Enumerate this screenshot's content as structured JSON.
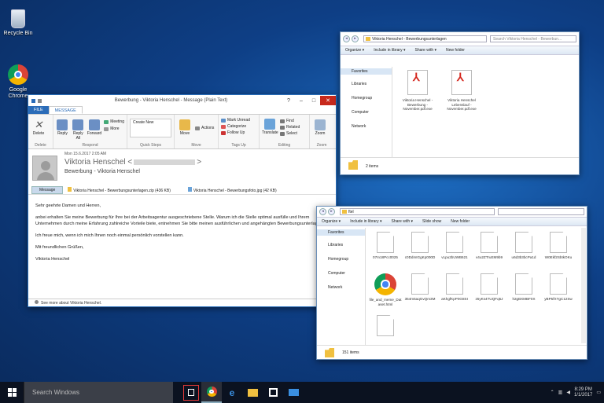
{
  "desktop": {
    "icons": [
      {
        "label": "Recycle Bin",
        "icon": "recycle-bin-icon"
      },
      {
        "label": "Google Chrome",
        "icon": "chrome-icon"
      }
    ]
  },
  "outlook": {
    "title": "Bewerbung - Viktoria Henschel - Message (Plain Text)",
    "tabs": [
      "FILE",
      "MESSAGE"
    ],
    "ribbon": {
      "delete": {
        "button": "Delete",
        "caption": "Delete"
      },
      "respond": {
        "reply": "Reply",
        "reply_all": "Reply All",
        "forward": "Forward",
        "meeting": "Meeting",
        "more": "More",
        "caption": "Respond"
      },
      "quicksteps": {
        "item": "Create New",
        "caption": "Quick Steps"
      },
      "move": {
        "move": "Move",
        "actions": "Actions",
        "caption": "Move"
      },
      "tags": {
        "mark_unread": "Mark Unread",
        "categorize": "Categorize",
        "follow_up": "Follow Up",
        "caption": "Tags Up"
      },
      "editing": {
        "translate": "Translate",
        "find": "Find",
        "related": "Related",
        "select": "Select",
        "caption": "Editing"
      },
      "zoom": {
        "zoom": "Zoom",
        "caption": "Zoom"
      }
    },
    "header": {
      "date": "Mon 15.6.2017 2:05 AM",
      "sender": "Viktoria Henschel <",
      "sender_end": ">",
      "subject": "Bewerbung - Viktoria Henschel"
    },
    "attachments": {
      "message_btn": "Message",
      "files": [
        "Viktoria Henschel - Bewerbungsunterlagen.zip (436 KB)",
        "Viktoria Henschel - Bewerbungsfoto.jpg (42 KB)"
      ]
    },
    "body": [
      "Sehr geehrte Damen und Herren,",
      "anbei erhalten Sie meine Bewerbung für Ihre bei der Arbeitsagentur ausgeschriebene Stelle. Warum ich die Stelle optimal ausfülle und Ihrem Unternehmen durch meine Erfahrung zahlreiche Vorteile biete, entnehmen Sie bitte meinen ausführlichen und angehängten Bewerbungsunterlagen.",
      "Ich freue mich, wenn ich mich Ihnen noch einmal persönlich vorstellen kann.",
      "Mit freundlichen Grüßen,",
      "Viktoria Henschel"
    ],
    "people_bar": "See more about Viktoria Henschel."
  },
  "explorer1": {
    "address": "Viktoria Henschel - Bewerbungsunterlagen",
    "search_placeholder": "Search Viktoria Henschel - Bewerbun...",
    "commands": [
      "Organize ▾",
      "Include in library ▾",
      "Share with ▾",
      "New folder"
    ],
    "nav": [
      "Favorites",
      "Libraries",
      "Homegroup",
      "Computer",
      "Network"
    ],
    "files": [
      "Viktoria Henschel - Bewerbung - November.pdf.exe",
      "Viktoria Henschel Lebenslauf - November.pdf.exe"
    ],
    "status": "2 items"
  },
  "explorer2": {
    "address": "ftel",
    "search_placeholder": "",
    "commands": [
      "Organize ▾",
      "Include in library ▾",
      "Share with ▾",
      "Slide show",
      "New folder"
    ],
    "nav": [
      "Favorites",
      "Libraries",
      "Homegroup",
      "Computer",
      "Network"
    ],
    "files": [
      "07m18Pcc0025",
      "c0DdmIGgKp000D",
      "vLpu2bUWB621",
      "v4u2ZTruEM9b9",
      "u6d3b3bcPa1d",
      "W0Ekf2SbtkOKu",
      "file_and_meme_Dataset.html",
      "354m5aqGvQm3M",
      "aKhgfKpP0G8SI",
      "z5yKs4TUQFq5J",
      "h2gBXMBF0X",
      "yBP5fXTgC12Sw",
      ""
    ],
    "status": "151 items"
  },
  "taskbar": {
    "search_placeholder": "Search Windows",
    "time": "8:29 PM",
    "date": "1/1/2017"
  },
  "colors": {
    "accent": "#2b6cb8",
    "desktop": "#0e3f86",
    "taskview_highlight": "#e53a3a"
  }
}
